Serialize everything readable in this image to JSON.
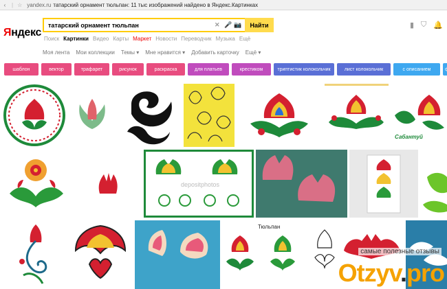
{
  "browser": {
    "back_glyph": "‹",
    "star_glyph": "☆",
    "domain": "yandex.ru",
    "title": "татарский орнамент тюльпан: 11 тыс изображений найдено в Яндекс.Картинках"
  },
  "header": {
    "logo_first": "Я",
    "logo_rest": "ндекс",
    "search_value": "татарский орнамент тюльпан",
    "search_button": "Найти",
    "clear_glyph": "✕",
    "mic_glyph": "🎤",
    "camera_glyph": "📷",
    "icons": {
      "bookmark": "▮",
      "shield": "⛉",
      "bell": "🔔"
    }
  },
  "tabs": [
    {
      "label": "Поиск"
    },
    {
      "label": "Картинки",
      "active": true
    },
    {
      "label": "Видео"
    },
    {
      "label": "Карты"
    },
    {
      "label": "Маркет",
      "market": true
    },
    {
      "label": "Новости"
    },
    {
      "label": "Переводчик"
    },
    {
      "label": "Музыка"
    },
    {
      "label": "Ещё"
    }
  ],
  "sub_tabs": [
    "Моя лента",
    "Мои коллекции",
    "Темы ▾",
    "Мне нравится ▾",
    "Добавить карточку",
    "Ещё ▾"
  ],
  "chips": [
    {
      "label": "шаблон",
      "color": "#e84c7f"
    },
    {
      "label": "вектор",
      "color": "#e84c7f"
    },
    {
      "label": "трафарет",
      "color": "#e84c7f"
    },
    {
      "label": "рисунок",
      "color": "#e84c7f"
    },
    {
      "label": "раскраска",
      "color": "#e84c7f"
    },
    {
      "label": "для платьев",
      "color": "#c04cbd"
    },
    {
      "label": "крестиком",
      "color": "#c04cbd"
    },
    {
      "label": "триптистик колокольчик",
      "color": "#5a6fd6"
    },
    {
      "label": "лист колокольчик",
      "color": "#5a6fd6"
    },
    {
      "label": "с описанием",
      "color": "#3ea8f0"
    },
    {
      "label": "ф",
      "color": "#3ea8f0"
    }
  ],
  "tiles": {
    "tulip_label": "Тюльпан",
    "sabantuy": "Сабантуй",
    "depositphotos": "depositphotos"
  },
  "watermark": {
    "caption": "самые полезные отзывы",
    "logo": "Otzyv",
    "logo_dot": ".",
    "logo_end": "pro"
  },
  "colors": {
    "accent_yellow": "#ffdb4d",
    "yandex_red": "#e00",
    "tulip_red": "#d42030",
    "leaf_green": "#2a9a3a"
  }
}
